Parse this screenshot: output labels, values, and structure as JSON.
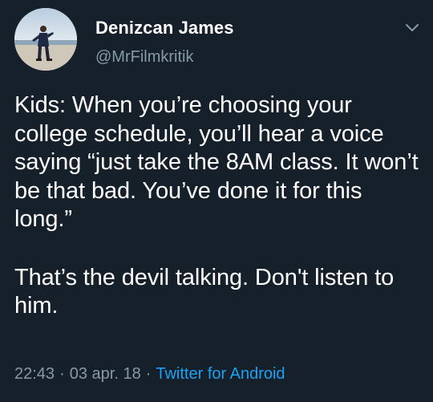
{
  "author": {
    "display_name": "Denizcan James",
    "handle": "@MrFilmkritik",
    "avatar_icon": "profile-photo"
  },
  "menu_icon": "chevron-down-icon",
  "tweet": {
    "line1": "Kids: When you’re choosing your college schedule, you’ll hear a voice saying “just take the 8AM class. It won’t be that bad. You’ve done it for this long.”",
    "line2": "That’s the devil talking. Don't listen to him."
  },
  "meta": {
    "time": "22:43",
    "date": "03 apr. 18",
    "separator": "·",
    "source": "Twitter for Android"
  },
  "colors": {
    "background": "#15202b",
    "text": "#ffffff",
    "secondary": "#8899a6",
    "link": "#1da1f2"
  }
}
